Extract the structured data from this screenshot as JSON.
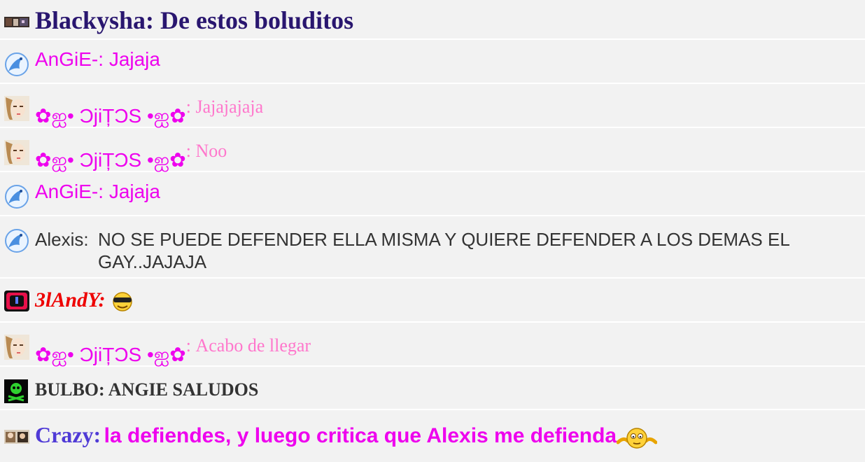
{
  "messages": [
    {
      "user": "Blackysha",
      "separator": ": ",
      "text": "De estos boluditos",
      "avatar": "photo-thumbnail-icon"
    },
    {
      "user": "AnGiE-",
      "separator": ": ",
      "text": "Jajaja",
      "avatar": "blue-bird-icon"
    },
    {
      "user_left": "✿ஐ• ",
      "user_mid": "ƆjiȚƆS",
      "user_right": " •ஐ✿",
      "separator": ": ",
      "text": "Jajajajaja",
      "avatar": "girl-portrait-icon"
    },
    {
      "user_left": "✿ஐ• ",
      "user_mid": "ƆjiȚƆS",
      "user_right": " •ஐ✿",
      "separator": ": ",
      "text": "Noo",
      "avatar": "girl-portrait-icon"
    },
    {
      "user": "AnGiE-",
      "separator": ": ",
      "text": "Jajaja",
      "avatar": "blue-bird-icon"
    },
    {
      "user": "Alexis",
      "separator": ":",
      "text": "NO SE PUEDE DEFENDER ELLA MISMA Y QUIERE DEFENDER A LOS DEMAS EL GAY..JAJAJA",
      "avatar": "blue-bird-icon"
    },
    {
      "user": "3lAndY",
      "separator": ":",
      "text": "",
      "avatar": "red-square-icon",
      "emoticon": "cool-face-icon"
    },
    {
      "user_left": "✿ஐ• ",
      "user_mid": "ƆjiȚƆS",
      "user_right": " •ஐ✿",
      "separator": ": ",
      "text": "Acabo de llegar",
      "avatar": "girl-portrait-icon"
    },
    {
      "user": "BULBO",
      "separator": ": ",
      "text": "ANGIE SALUDOS",
      "avatar": "green-skull-icon"
    },
    {
      "user": "Crazy",
      "separator": ":",
      "text": "la defiendes, y luego critica que Alexis me defienda",
      "avatar": "couple-photo-icon",
      "emoticon": "shrug-face-icon"
    }
  ],
  "colors": {
    "background": "#f2f2f2",
    "row_divider": "#ffffff",
    "blackysha": "#29166f",
    "angie": "#ee00ee",
    "ojitos_msg": "#ff77cc",
    "alexis": "#333333",
    "andy": "#ee0000",
    "crazy_name": "#4f3ad6"
  }
}
